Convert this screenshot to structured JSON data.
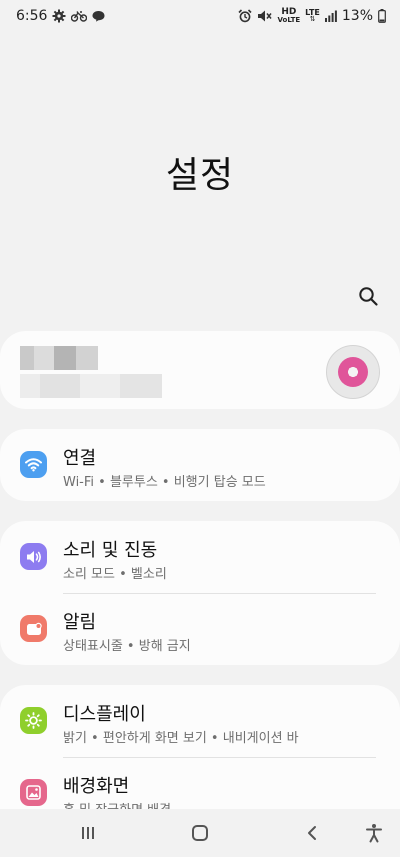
{
  "status_bar": {
    "time": "6:56",
    "network_hd": "HD",
    "network_volte": "VoLTE",
    "network_lte": "LTE",
    "battery_percent": "13%"
  },
  "page": {
    "title": "설정"
  },
  "account": {},
  "settings": {
    "connections": {
      "title": "연결",
      "subtitle": "Wi-Fi • 블루투스 • 비행기 탑승 모드"
    },
    "sound": {
      "title": "소리 및 진동",
      "subtitle": "소리 모드 • 벨소리"
    },
    "notifications": {
      "title": "알림",
      "subtitle": "상태표시줄 • 방해 금지"
    },
    "display": {
      "title": "디스플레이",
      "subtitle": "밝기 • 편안하게 화면 보기 • 내비게이션 바"
    },
    "wallpaper": {
      "title": "배경화면",
      "subtitle": "홈 및 잠금화면 배경"
    }
  },
  "colors": {
    "connections_icon": "#4d9ff0",
    "sound_icon": "#8d7cf0",
    "notifications_icon": "#f07a6a",
    "display_icon": "#8fcf2c",
    "wallpaper_icon": "#e5678c"
  },
  "nav": {
    "recents_icon": "recents-icon",
    "home_icon": "home-icon",
    "back_icon": "back-icon",
    "accessibility_icon": "accessibility-icon"
  }
}
